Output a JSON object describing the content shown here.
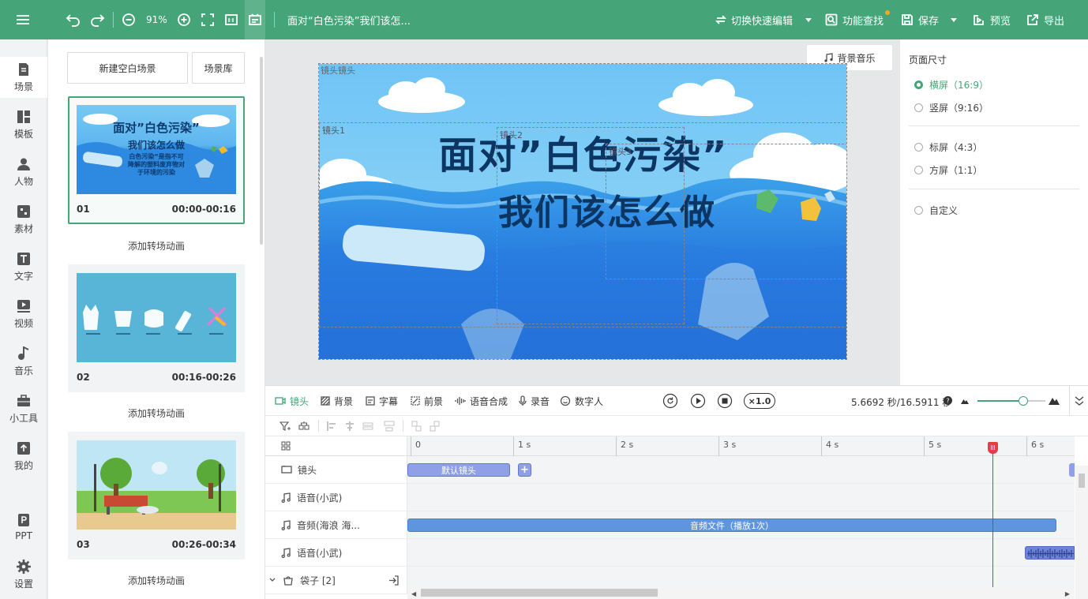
{
  "topbar": {
    "zoom": "91%",
    "doc_title": "面对“白色污染”我们该怎...",
    "quick_edit": "切换快速编辑",
    "feature_search": "功能查找",
    "save": "保存",
    "preview": "预览",
    "export": "导出"
  },
  "leftnav": {
    "items": [
      {
        "label": "场景",
        "icon": "scene-icon"
      },
      {
        "label": "模板",
        "icon": "template-icon"
      },
      {
        "label": "人物",
        "icon": "person-icon"
      },
      {
        "label": "素材",
        "icon": "material-icon"
      },
      {
        "label": "文字",
        "icon": "text-icon"
      },
      {
        "label": "视频",
        "icon": "video-icon"
      },
      {
        "label": "音乐",
        "icon": "music-icon"
      },
      {
        "label": "小工具",
        "icon": "toolbox-icon"
      },
      {
        "label": "我的",
        "icon": "upload-icon"
      },
      {
        "label": "PPT",
        "icon": "ppt-icon"
      },
      {
        "label": "设置",
        "icon": "settings-gear-icon"
      }
    ]
  },
  "scenes": {
    "new_blank": "新建空白场景",
    "library": "场景库",
    "add_transition": "添加转场动画",
    "items": [
      {
        "num": "01",
        "time": "00:00-00:16",
        "thumb_title_1": "面对”白色污染”",
        "thumb_title_2": "我们该怎么做",
        "thumb_text_1": "白色污染“是指不可",
        "thumb_text_2": "降解的塑料废弃物对",
        "thumb_text_3": "于环境的污染"
      },
      {
        "num": "02",
        "time": "00:16-00:26"
      },
      {
        "num": "03",
        "time": "00:26-00:34"
      }
    ]
  },
  "stage": {
    "bg_music": "背景音乐",
    "title_line1": "面对”白色污染”",
    "title_line2": "我们该怎么做",
    "lens_labels": [
      "镜头镜头",
      "镜头1",
      "镜头2",
      "镜头3"
    ]
  },
  "page_size": {
    "heading": "页面尺寸",
    "options": [
      {
        "label": "横屏（16:9）",
        "selected": true
      },
      {
        "label": "竖屏（9:16）",
        "selected": false
      },
      {
        "label": "标屏（4:3）",
        "selected": false
      },
      {
        "label": "方屏（1:1）",
        "selected": false
      },
      {
        "label": "自定义",
        "selected": false
      }
    ]
  },
  "timeline": {
    "tabs": [
      "镜头",
      "背景",
      "字幕",
      "前景",
      "语音合成",
      "录音",
      "数字人"
    ],
    "speed": "×1.0",
    "time_readout": "5.6692 秒/16.5911 秒",
    "ruler": [
      "0",
      "1 s",
      "2 s",
      "3 s",
      "4 s",
      "5 s",
      "6 s"
    ],
    "tracks": [
      {
        "label": "镜头",
        "icon": "camera-icon"
      },
      {
        "label": "语音(小武)",
        "icon": "music-note-icon"
      },
      {
        "label": "音频(海浪 海...",
        "icon": "music-note-icon"
      },
      {
        "label": "语音(小武)",
        "icon": "music-note-icon"
      },
      {
        "label": "袋子 [2]",
        "icon": "bag-icon"
      }
    ],
    "default_lens_clip": "默认镜头",
    "add_clip": "+",
    "audio_clip": "音频文件（播放1次）",
    "playhead_seconds": 5.6692,
    "duration_seconds": 16.5911,
    "volume_level": 0.68
  },
  "colors": {
    "brand": "#45a578",
    "clip": "#7b8fdc",
    "audio_clip": "#5f95dc",
    "playhead": "#d92c3a"
  }
}
